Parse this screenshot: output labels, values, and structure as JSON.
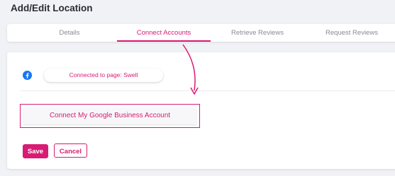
{
  "page": {
    "title": "Add/Edit Location"
  },
  "tabs": [
    {
      "label": "Details",
      "active": false
    },
    {
      "label": "Connect Accounts",
      "active": true
    },
    {
      "label": "Retrieve Reviews",
      "active": false
    },
    {
      "label": "Request Reviews",
      "active": false
    }
  ],
  "facebook": {
    "icon": "facebook-icon",
    "status": "Connected to page: Swell"
  },
  "google": {
    "button_label": "Connect My Google Business Account"
  },
  "actions": {
    "save_label": "Save",
    "cancel_label": "Cancel"
  },
  "colors": {
    "accent": "#d81b74",
    "facebook": "#1877f2",
    "background": "#f1f2f5"
  }
}
